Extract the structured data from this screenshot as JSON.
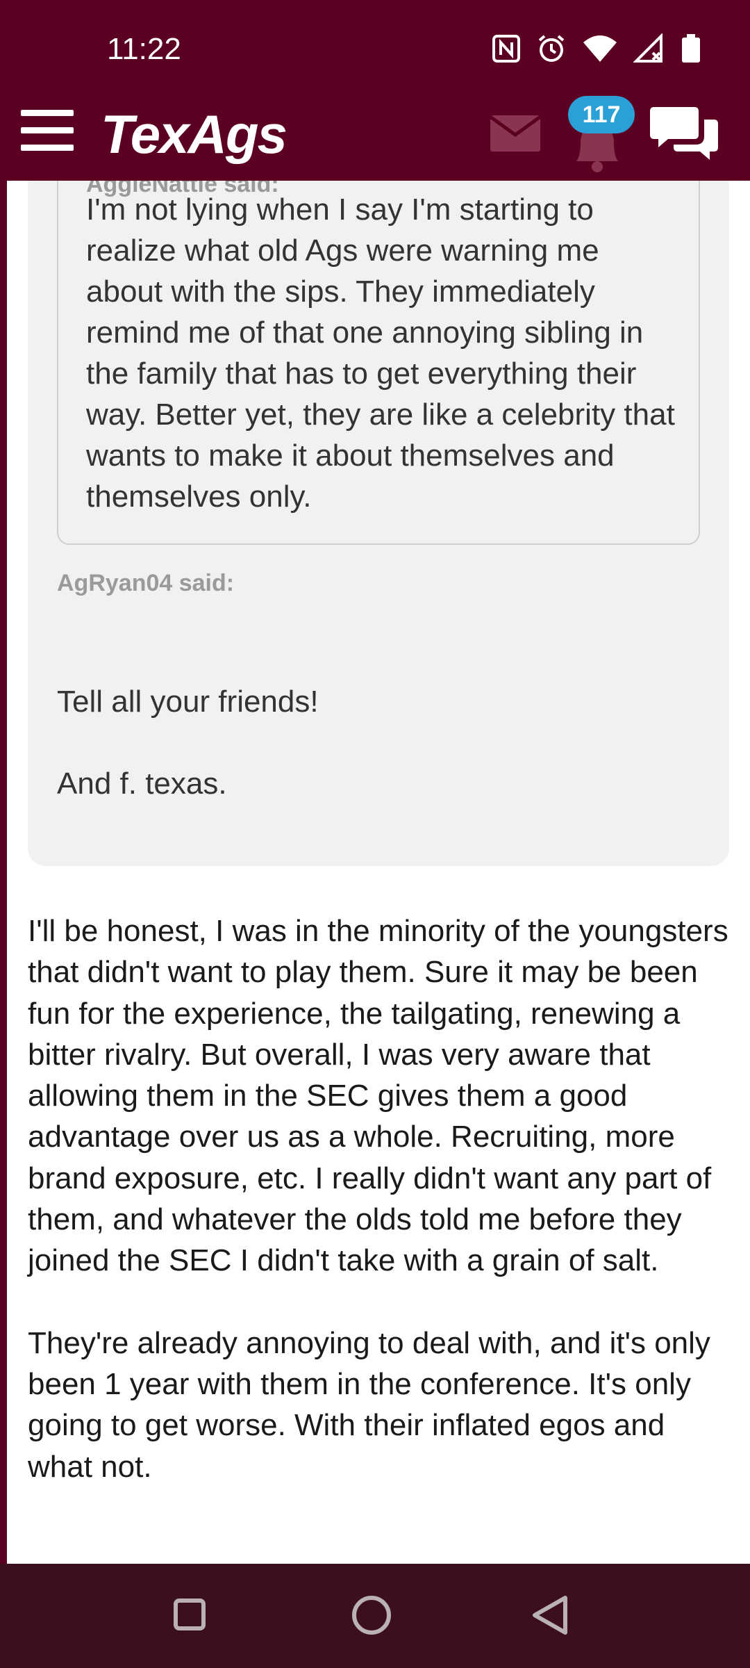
{
  "status_bar": {
    "time": "11:22"
  },
  "header": {
    "logo": "TexAgs",
    "notification_count": "117"
  },
  "quote": {
    "inner_author_said": "AggieNattie said:",
    "inner_text": "I'm not lying when I say I'm starting to realize what old Ags were warning me about with the sips. They immediately remind me of that one annoying sibling in the family that has to get everything their way. Better yet, they are like a celebrity that wants to make it about themselves and themselves only.",
    "outer_author_said": "AgRyan04 said:",
    "outer_line1": "Tell all your friends!",
    "outer_line2": "And f. texas."
  },
  "post": {
    "paragraph1": "I'll be honest, I was in the minority of the youngsters that didn't want to play them. Sure it may be been fun for the experience, the tailgating, renewing a bitter rivalry. But overall, I was very aware that allowing them in the SEC gives them a good advantage over us as a whole. Recruiting, more brand exposure, etc. I really didn't want any part of them, and whatever the olds told me before they joined the SEC I didn't take with a grain of salt.",
    "paragraph2": "They're already annoying to deal with, and it's only been 1 year with them in the conference. It's only going to get worse. With their inflated egos and what not."
  },
  "icons": {
    "menu": "hamburger-icon",
    "mail": "mail-icon",
    "bell": "bell-icon",
    "chat": "chat-bubbles-icon",
    "recents": "square-icon",
    "home": "circle-icon",
    "back": "triangle-back-icon"
  },
  "colors": {
    "brand": "#5b0022",
    "badge": "#2aa0d6",
    "nav_bar": "#3b0f1c"
  }
}
